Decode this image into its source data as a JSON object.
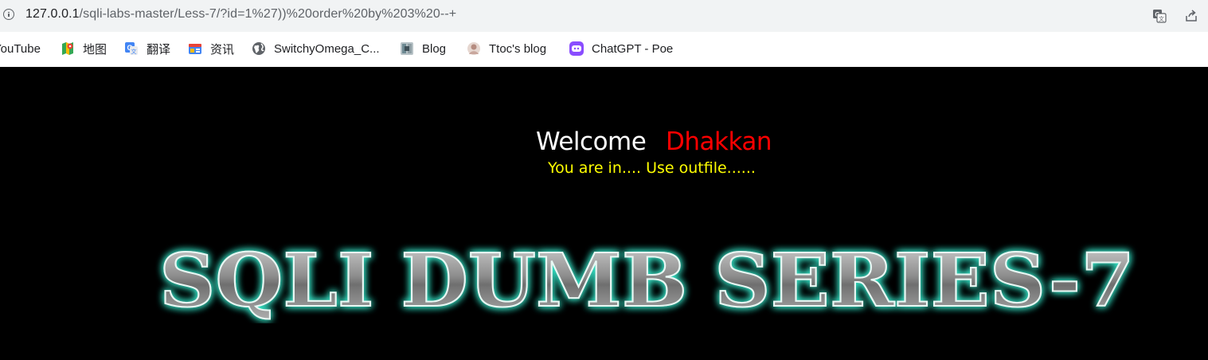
{
  "browser": {
    "url_host": "127.0.0.1",
    "url_rest": "/sqli-labs-master/Less-7/?id=1%27))%20order%20by%203%20--+",
    "icons": [
      "info-icon",
      "translate-icon",
      "share-icon"
    ],
    "bookmarks": [
      {
        "label": "YouTube",
        "icon": "youtube-icon"
      },
      {
        "label": "地图",
        "icon": "maps-icon"
      },
      {
        "label": "翻译",
        "icon": "translate-icon"
      },
      {
        "label": "资讯",
        "icon": "news-icon"
      },
      {
        "label": "SwitchyOmega_C...",
        "icon": "globe-icon"
      },
      {
        "label": "Blog",
        "icon": "blog-icon"
      },
      {
        "label": "Ttoc's blog",
        "icon": "avatar-icon"
      },
      {
        "label": "ChatGPT - Poe",
        "icon": "poe-icon"
      }
    ]
  },
  "page": {
    "welcome": "Welcome",
    "username": "Dhakkan",
    "message": "You are in.... Use outfile......",
    "banner_text": "SQLI DUMB SERIES-7",
    "colors": {
      "background": "#000000",
      "welcome": "#ffffff",
      "username": "#ff0000",
      "message": "#ffff00",
      "banner_glow": "#35e0c4",
      "banner_fill": "#8a8a8a"
    }
  }
}
